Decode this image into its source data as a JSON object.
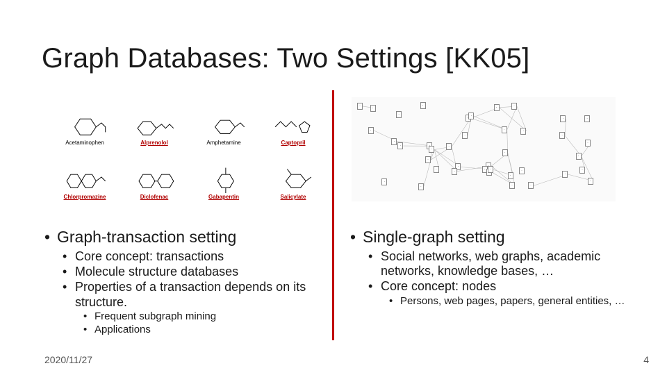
{
  "title": "Graph Databases: Two Settings  [KK05]",
  "footer": {
    "date": "2020/11/27",
    "page": "4"
  },
  "molecules": [
    {
      "label": "Acetaminophen",
      "red": false
    },
    {
      "label": "Alprenolol",
      "red": true
    },
    {
      "label": "Amphetamine",
      "red": false
    },
    {
      "label": "Captopril",
      "red": true
    },
    {
      "label": "Chlorpromazine",
      "red": true
    },
    {
      "label": "Diclofenac",
      "red": true
    },
    {
      "label": "Gabapentin",
      "red": true
    },
    {
      "label": "Salicylate",
      "red": true
    }
  ],
  "left": {
    "heading": "Graph-transaction setting",
    "l2": [
      "Core concept: transactions",
      "Molecule structure databases",
      "Properties of a transaction depends on its structure."
    ],
    "l3": [
      "Frequent subgraph mining",
      "Applications"
    ]
  },
  "right": {
    "heading": "Single-graph setting",
    "l2": [
      "Social networks, web graphs, academic networks, knowledge bases, …",
      "Core concept: nodes"
    ],
    "l3": [
      "Persons, web pages, papers, general entities, …"
    ]
  }
}
